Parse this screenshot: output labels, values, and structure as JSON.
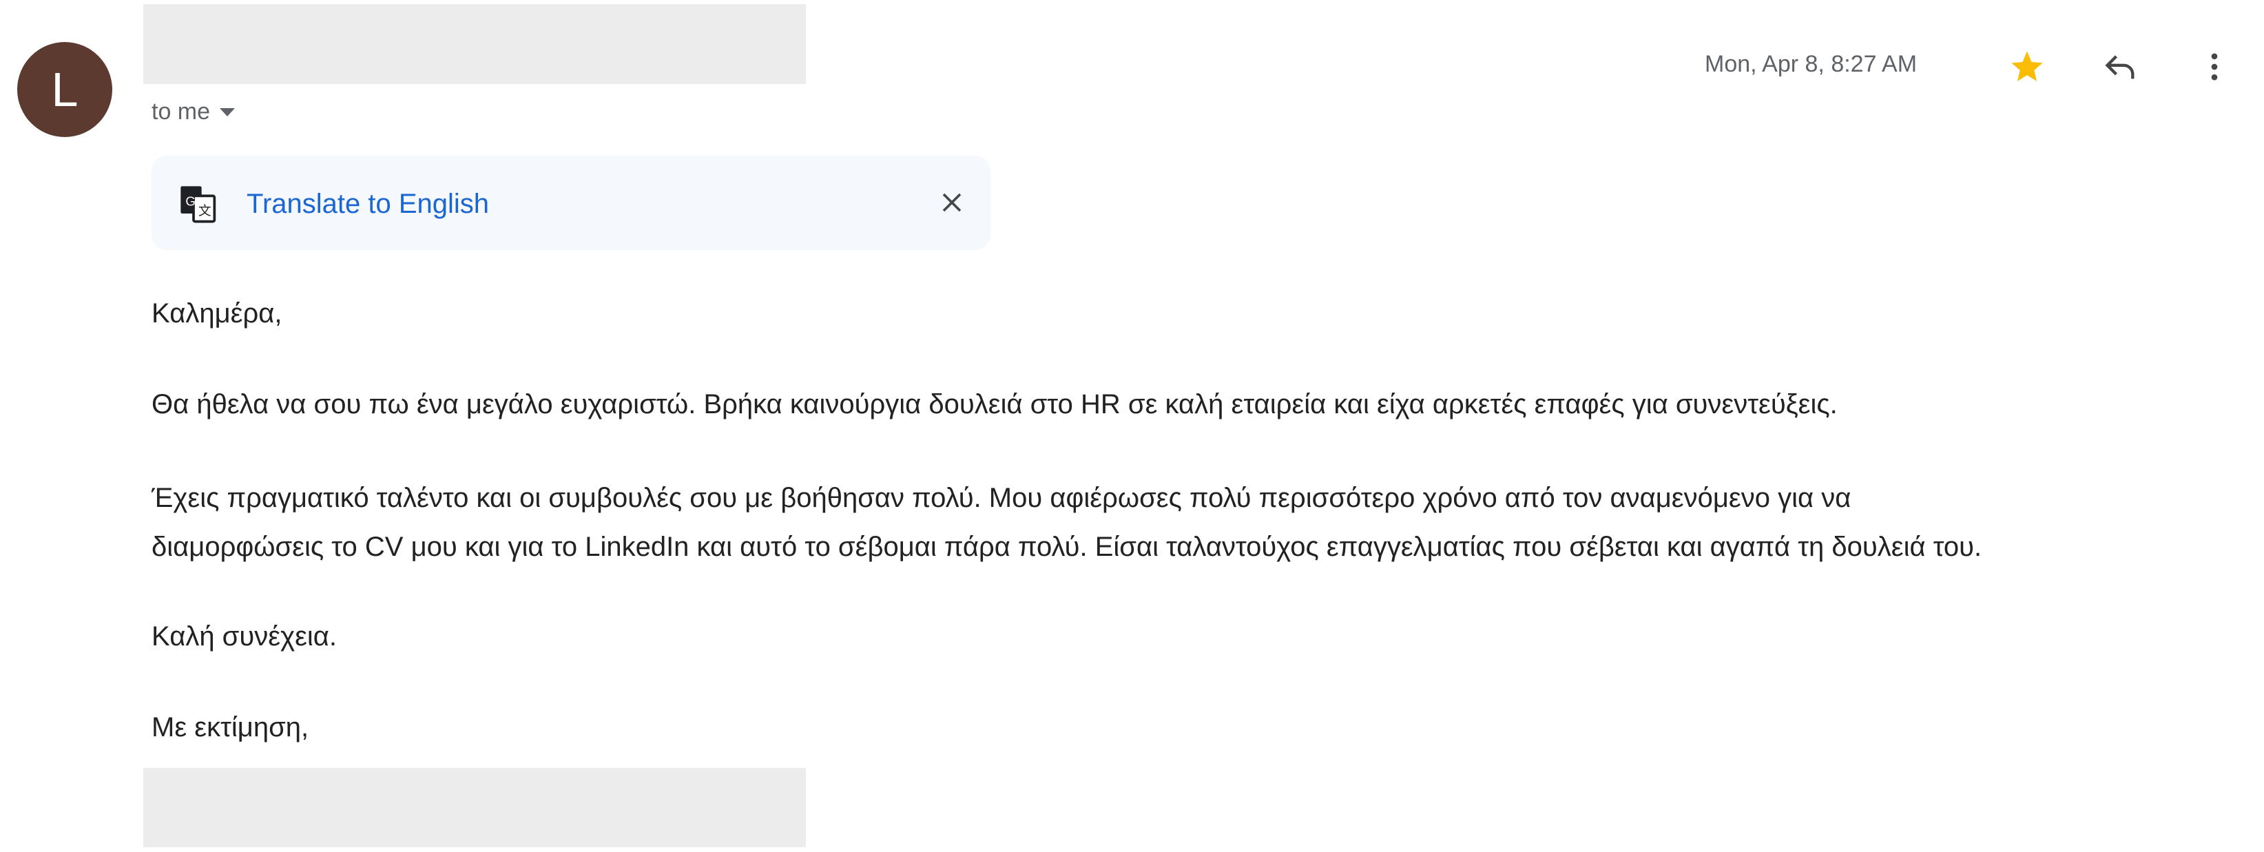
{
  "sender": {
    "avatar_letter": "L"
  },
  "recipient": {
    "label": "to me"
  },
  "header": {
    "date": "Mon, Apr 8, 8:27 AM",
    "starred": true,
    "colors": {
      "star": "#fbbc04",
      "avatar": "#5d3a30",
      "link": "#1a66d2"
    }
  },
  "translate": {
    "label": "Translate to English"
  },
  "body": {
    "greeting": "Καλημέρα,",
    "paragraph1": "Θα ήθελα να σου πω ένα μεγάλο ευχαριστώ. Βρήκα καινούργια δουλειά στο HR σε καλή εταιρεία και είχα αρκετές επαφές για συνεντεύξεις.",
    "paragraph2_line1": "Έχεις πραγματικό ταλέντο και οι συμβουλές σου με βοήθησαν πολύ. Μου αφιέρωσες πολύ περισσότερο χρόνο από τον αναμενόμενο για να",
    "paragraph2_line2": "διαμορφώσεις το CV μου και για το LinkedIn και αυτό το σέβομαι πάρα πολύ. Είσαι ταλαντούχος επαγγελματίας που σέβεται και αγαπά τη δουλειά του.",
    "closing": "Καλή συνέχεια.",
    "signoff": "Με εκτίμηση,"
  }
}
